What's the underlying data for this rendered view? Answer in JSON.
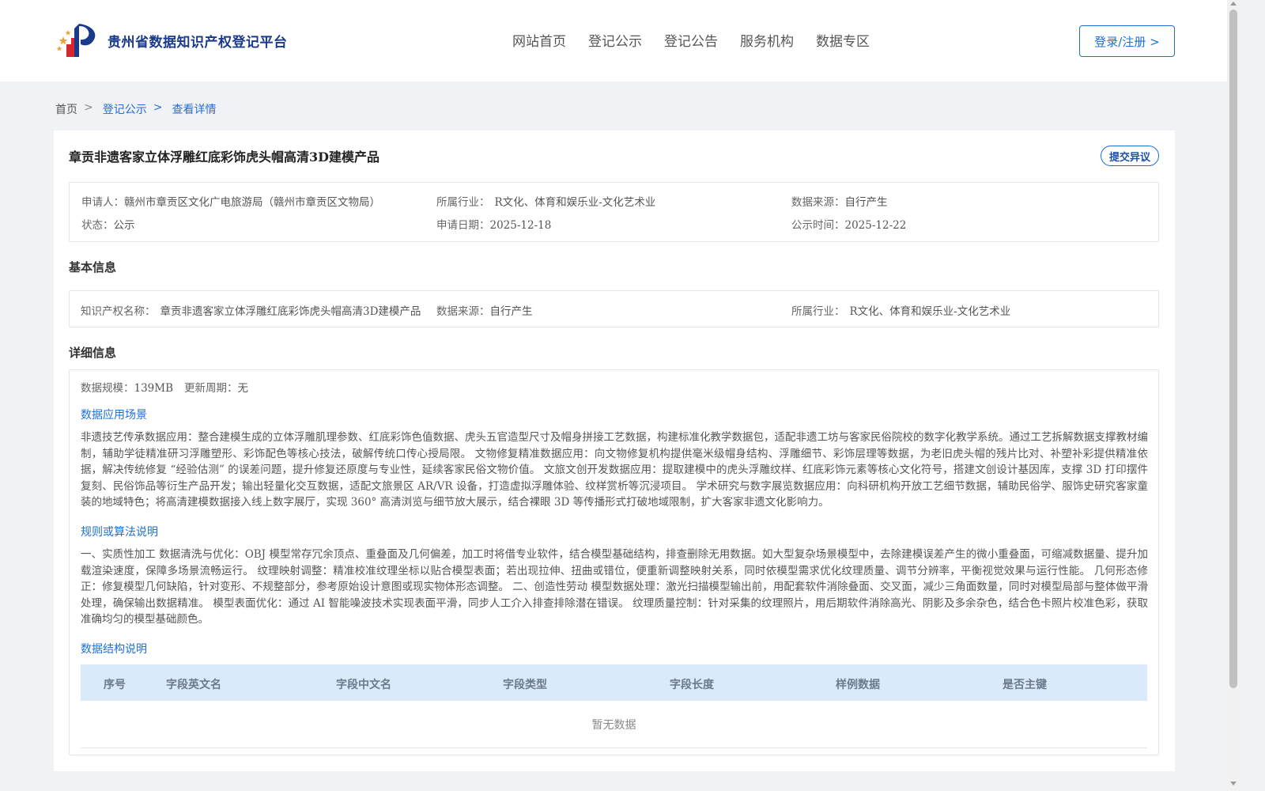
{
  "header": {
    "site_name": "贵州省数据知识产权登记平台",
    "nav": [
      "网站首页",
      "登记公示",
      "登记公告",
      "服务机构",
      "数据专区"
    ],
    "login_label": "登录/注册 >"
  },
  "breadcrumb": {
    "home": "首页",
    "sep": ">",
    "level1": "登记公示",
    "current": "查看详情"
  },
  "record": {
    "title": "章贡非遗客家立体浮雕红底彩饰虎头帽高清3D建模产品",
    "objection_label": "提交异议",
    "summary": {
      "applicant_label": "申请人：",
      "applicant": "赣州市章贡区文化广电旅游局（赣州市章贡区文物局）",
      "industry_label": "所属行业：",
      "industry": "R文化、体育和娱乐业-文化艺术业",
      "source_label": "数据来源：",
      "source": "自行产生",
      "status_label": "状态：",
      "status": "公示",
      "apply_date_label": "申请日期：",
      "apply_date": "2025-12-18",
      "publicity_label": "公示时间：",
      "publicity_date": "2025-12-22"
    },
    "basic": {
      "section_title": "基本信息",
      "ip_name_label": "知识产权名称：",
      "ip_name": "章贡非遗客家立体浮雕红底彩饰虎头帽高清3D建模产品",
      "source_label": "数据来源：",
      "source": "自行产生",
      "industry_label": "所属行业：",
      "industry": "R文化、体育和娱乐业-文化艺术业"
    },
    "detail": {
      "section_title": "详细信息",
      "scale_label": "数据规模：",
      "scale": "139MB",
      "cycle_label": "更新周期：",
      "cycle": "无",
      "scenario_title": "数据应用场景",
      "scenario_text": "非遗技艺传承数据应用：整合建模生成的立体浮雕肌理参数、红底彩饰色值数据、虎头五官造型尺寸及帽身拼接工艺数据，构建标准化教学数据包，适配非遗工坊与客家民俗院校的数字化教学系统。通过工艺拆解数据支撑教材编制，辅助学徒精准研习浮雕塑形、彩饰配色等核心技法，破解传统口传心授局限。 文物修复精准数据应用：向文物修复机构提供毫米级帽身结构、浮雕细节、彩饰层理等数据，为老旧虎头帽的残片比对、补塑补彩提供精准依据，解决传统修复 “经验估测” 的误差问题，提升修复还原度与专业性，延续客家民俗文物价值。 文旅文创开发数据应用：提取建模中的虎头浮雕纹样、红底彩饰元素等核心文化符号，搭建文创设计基因库，支撑 3D 打印摆件复刻、民俗饰品等衍生产品开发；输出轻量化交互数据，适配文旅景区 AR/VR 设备，打造虚拟浮雕体验、纹样赏析等沉浸项目。 学术研究与数字展览数据应用：向科研机构开放工艺细节数据，辅助民俗学、服饰史研究客家童装的地域特色；将高清建模数据接入线上数字展厅，实现 360° 高清浏览与细节放大展示，结合裸眼 3D 等传播形式打破地域限制，扩大客家非遗文化影响力。",
      "rule_title": "规则或算法说明",
      "rule_text": "一、实质性加工 数据清洗与优化：OBJ 模型常存冗余顶点、重叠面及几何偏差，加工时将借专业软件，结合模型基础结构，排查删除无用数据。如大型复杂场景模型中，去除建模误差产生的微小重叠面，可缩减数据量、提升加载渲染速度，保障多场景流畅运行。 纹理映射调整：精准校准纹理坐标以贴合模型表面；若出现拉伸、扭曲或错位，便重新调整映射关系，同时依模型需求优化纹理质量、调节分辨率，平衡视觉效果与运行性能。 几何形态修正：修复模型几何缺陷，针对变形、不规整部分，参考原始设计意图或现实物体形态调整。 二、创造性劳动 模型数据处理：激光扫描模型输出前，用配套软件消除叠面、交叉面，减少三角面数量，同时对模型局部与整体做平滑处理，确保输出数据精准。 模型表面优化：通过 AI 智能噪波技术实现表面平滑，同步人工介入排查排除潜在错误。 纹理质量控制：针对采集的纹理照片，用后期软件消除高光、阴影及多余杂色，结合色卡照片校准色彩，获取准确均匀的模型基础颜色。",
      "structure_title": "数据结构说明",
      "table_headers": [
        "序号",
        "字段英文名",
        "字段中文名",
        "字段类型",
        "字段长度",
        "样例数据",
        "是否主键"
      ],
      "empty_text": "暂无数据"
    }
  },
  "colors": {
    "accent": "#1f6fd6",
    "table_header_bg": "#dbeafa",
    "page_bg": "#f0f2f5"
  }
}
